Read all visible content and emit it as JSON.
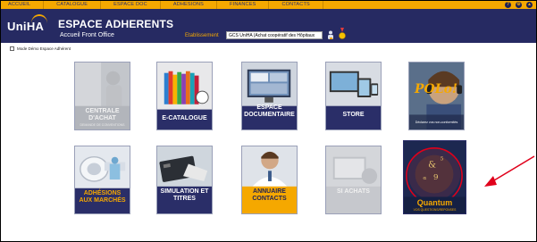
{
  "nav": {
    "items": [
      "ACCUEIL",
      "CATALOGUE",
      "ESPACE DOC",
      "ADHESIONS",
      "FINANCES",
      "CONTACTS"
    ]
  },
  "header": {
    "logo": "UniHA",
    "title": "ESPACE ADHERENTS",
    "subtitle": "Accueil Front Office",
    "etab_label": "Etablissement",
    "etab_value": "GCS UniHA (Achat coopératif des Hôpitaux"
  },
  "mode_label": "Mode Démo Espace Adhérent",
  "tiles": {
    "centrale": {
      "label1": "CENTRALE D'ACHAT",
      "label2": "DEMANDE DE CONVENTIONS"
    },
    "ecatalogue": {
      "label": "E-CATALOGUE"
    },
    "documentaire": {
      "label": "ESPACE DOCUMENTAIRE"
    },
    "store": {
      "label": "STORE"
    },
    "polo": {
      "label": "POLo!",
      "sub": "Déclarez vos non-conformités"
    },
    "adhesions": {
      "label": "ADHÉSIONS AUX MARCHÉS"
    },
    "simulation": {
      "label": "SIMULATION ET TITRES"
    },
    "annuaire": {
      "label": "ANNUAIRE CONTACTS"
    },
    "siachats": {
      "label": "SI ACHATS"
    },
    "quantum": {
      "label": "Quantum",
      "sub": "VOS QUESTIONS/REPONSES"
    }
  },
  "colors": {
    "accent": "#f5a800",
    "navy": "#262a62",
    "annotation": "#e0001b"
  }
}
